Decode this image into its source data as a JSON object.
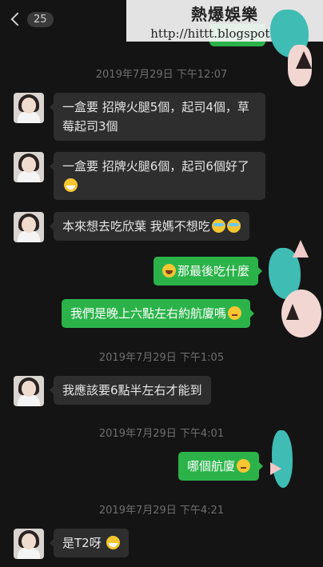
{
  "header": {
    "back_count": "25"
  },
  "watermark": {
    "title": "熱爆娛樂",
    "url": "http://hittt.blogspot.com"
  },
  "messages": [
    {
      "type": "time",
      "text": "2019年7月29日 下午12:07"
    },
    {
      "type": "in",
      "text": "一盒要 招牌火腿5個，起司4個，草莓起司3個"
    },
    {
      "type": "in",
      "text": "一盒要 招牌火腿6個，起司6個好了",
      "emoji": "grin-emoji"
    },
    {
      "type": "in",
      "text": "本來想去吃欣葉 我媽不想吃",
      "emoji": "crying-emoji"
    },
    {
      "type": "out",
      "text": "那最後吃什麼",
      "emoji": "laughing-emoji"
    },
    {
      "type": "out",
      "text": "我們是晚上六點左右約航廈嗎",
      "emoji": "thinking-emoji"
    },
    {
      "type": "time",
      "text": "2019年7月29日 下午1:05"
    },
    {
      "type": "in",
      "text": "我應該要6點半左右才能到"
    },
    {
      "type": "time",
      "text": "2019年7月29日 下午4:01"
    },
    {
      "type": "out",
      "text": "哪個航廈",
      "emoji": "thinking-emoji"
    },
    {
      "type": "time",
      "text": "2019年7月29日 下午4:21"
    },
    {
      "type": "in",
      "text": "是T2呀",
      "emoji": "grin-emoji"
    }
  ],
  "colors": {
    "background": "#141414",
    "incoming_bubble": "#2e2e2e",
    "outgoing_bubble": "#2bb34a",
    "timestamp": "#6f6f6f"
  }
}
